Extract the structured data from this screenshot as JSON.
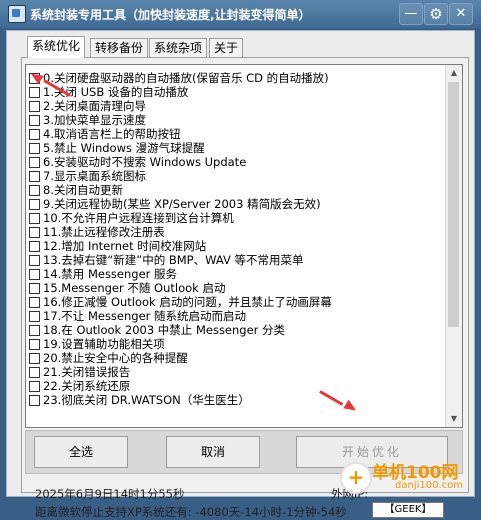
{
  "window": {
    "title": "系统封装专用工具（加快封装速度,让封装变得简单）",
    "min_symbol": "—",
    "settings_symbol": "⚙",
    "close_symbol": "✕"
  },
  "tabs": [
    {
      "label": "系统优化",
      "active": true
    },
    {
      "label": "转移备份",
      "active": false
    },
    {
      "label": "系统杂项",
      "active": false
    },
    {
      "label": "关于",
      "active": false
    }
  ],
  "options": [
    "0.关闭硬盘驱动器的自动播放(保留音乐 CD 的自动播放)",
    "1.关闭 USB 设备的自动播放",
    "2.关闭桌面清理向导",
    "3.加快菜单显示速度",
    "4.取消语言栏上的帮助按钮",
    "5.禁止 Windows 漫游气球提醒",
    "6.安装驱动时不搜索 Windows Update",
    "7.显示桌面系统图标",
    "8.关闭自动更新",
    "9.关闭远程协助(某些 XP/Server 2003 精简版会无效)",
    "10.不允许用户远程连接到这台计算机",
    "11.禁止远程修改注册表",
    "12.增加 Internet 时间校准网站",
    "13.去掉右键“新建”中的 BMP、WAV 等不常用菜单",
    "14.禁用 Messenger 服务",
    "15.Messenger 不随 Outlook 启动",
    "16.修正减慢 Outlook 启动的问题，并且禁止了动画屏幕",
    "17.不让 Messenger 随系统启动而启动",
    "18.在 Outlook 2003 中禁止 Messenger 分类",
    "19.设置辅助功能相关项",
    "20.禁止安全中心的各种提醒",
    "21.关闭错误报告",
    "22.关闭系统还原",
    "23.彻底关闭 DR.WATSON（华生医生）"
  ],
  "buttons": {
    "select_all": "全选",
    "cancel": "取消",
    "start": "开始优化"
  },
  "status": {
    "date_line": "2025年6月9日14时1分55秒",
    "countdown_line": "距离微软停止支持XP系统还有: -4080天-14小时-1分钟-54秒",
    "outer_ip_label": "外网IP:",
    "geek_label": "【GEEK】"
  },
  "watermark": {
    "logo_char": "+",
    "name": "单机100网",
    "url": "danji100.com"
  },
  "colors": {
    "titlebar": "#4a769f",
    "annotation_arrow": "#e8353c",
    "watermark": "#f39800"
  }
}
